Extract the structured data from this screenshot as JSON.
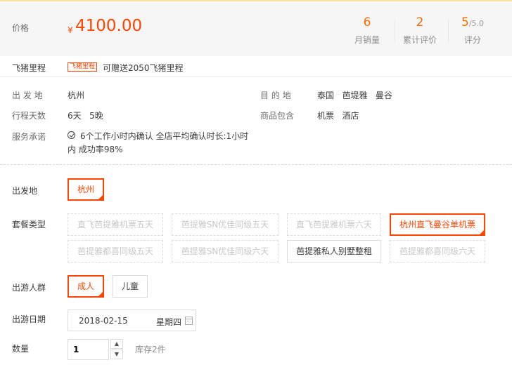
{
  "price": {
    "label": "价格",
    "currency": "¥",
    "value": "4100.00"
  },
  "stats": [
    {
      "value": "6",
      "suffix": "",
      "label": "月销量"
    },
    {
      "value": "2",
      "suffix": "",
      "label": "累计评价"
    },
    {
      "value": "5",
      "suffix": "/5.0",
      "label": "评分"
    }
  ],
  "mileage": {
    "label": "飞猪里程",
    "tag": "飞猪里程",
    "text": "可赠送2050飞猪里程"
  },
  "info": {
    "departure": {
      "label": "出 发 地",
      "value": "杭州"
    },
    "destination": {
      "label": "目 的 地",
      "value": "泰国   芭堤雅   曼谷"
    },
    "duration": {
      "label": "行程天数",
      "value": "6天   5晚"
    },
    "includes": {
      "label": "商品包含",
      "value": "机票   酒店"
    },
    "promise": {
      "label": "服务承诺",
      "text": "6个工作小时内确认 全店平均确认时长:1小时内 成功率98%"
    }
  },
  "options": {
    "departure": {
      "label": "出发地",
      "items": [
        "杭州"
      ]
    },
    "package": {
      "label": "套餐类型",
      "items": [
        "直飞芭提雅机票五天",
        "芭提雅SN优佳同级五天",
        "直飞芭提雅机票六天",
        "杭州直飞曼谷单机票",
        "芭提雅都喜同级五天",
        "芭提雅SN优佳同级六天",
        "芭提雅私人别墅整租",
        "芭提雅都喜同级六天"
      ]
    },
    "travelers": {
      "label": "出游人群",
      "items": [
        "成人",
        "儿童"
      ]
    },
    "date": {
      "label": "出游日期",
      "value": "2018-02-15",
      "weekday": "星期四"
    },
    "quantity": {
      "label": "数量",
      "value": "1",
      "stock": "库存2件"
    }
  },
  "colors": {
    "accent": "#ff4400",
    "stat": "#ff6a00",
    "band": "#f6f6f6"
  },
  "icons": {
    "promise": "check-circle-icon",
    "calendar": "calendar-icon",
    "up": "chevron-up-icon",
    "down": "chevron-down-icon"
  }
}
